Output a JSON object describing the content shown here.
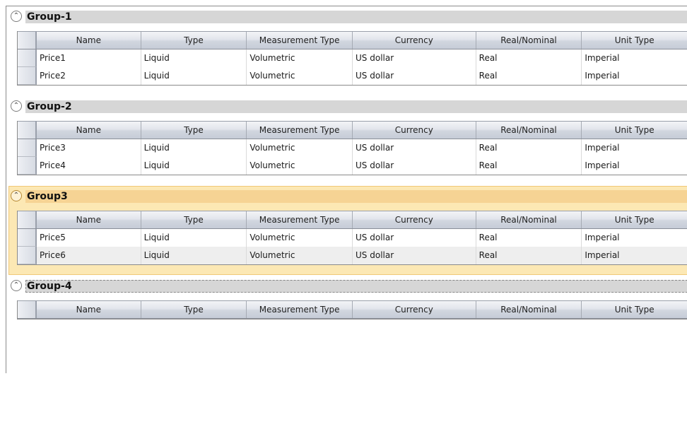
{
  "columns": [
    "Name",
    "Type",
    "Measurement Type",
    "Currency",
    "Real/Nominal",
    "Unit Type"
  ],
  "groups": [
    {
      "title": "Group-1",
      "rows": [
        [
          "Price1",
          "Liquid",
          "Volumetric",
          "US dollar",
          "Real",
          "Imperial"
        ],
        [
          "Price2",
          "Liquid",
          "Volumetric",
          "US dollar",
          "Real",
          "Imperial"
        ]
      ]
    },
    {
      "title": "Group-2",
      "rows": [
        [
          "Price3",
          "Liquid",
          "Volumetric",
          "US dollar",
          "Real",
          "Imperial"
        ],
        [
          "Price4",
          "Liquid",
          "Volumetric",
          "US dollar",
          "Real",
          "Imperial"
        ]
      ]
    },
    {
      "title": "Group3",
      "rows": [
        [
          "Price5",
          "Liquid",
          "Volumetric",
          "US dollar",
          "Real",
          "Imperial"
        ],
        [
          "Price6",
          "Liquid",
          "Volumetric",
          "US dollar",
          "Real",
          "Imperial"
        ]
      ]
    },
    {
      "title": "Group-4",
      "rows": []
    }
  ],
  "toggle_icon": "chevron-up-icon",
  "colors": {
    "group_header": "#d6d6d6",
    "selected_group_panel": "#fce8b4",
    "selected_group_header": "#f6d394"
  }
}
